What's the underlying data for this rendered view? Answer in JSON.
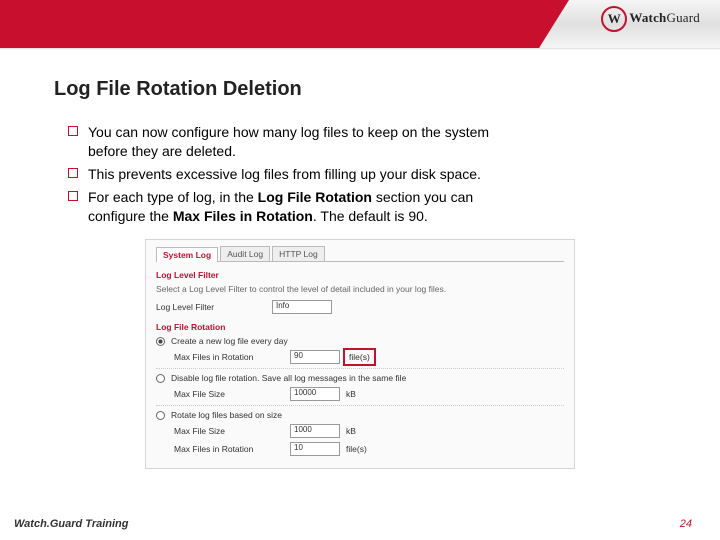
{
  "brand": {
    "name_a": "Watch",
    "name_b": "Guard",
    "mark": "W"
  },
  "title": "Log File Rotation Deletion",
  "bullets": {
    "b1a": "You can now configure how many log files to keep on the system",
    "b1b": "before they are deleted.",
    "b2": "This prevents excessive log files from filling up your disk space.",
    "b3a": "For each type of log, in the ",
    "b3bold1": "Log File Rotation",
    "b3b": " section you can",
    "b3c": "configure the ",
    "b3bold2": "Max Files in Rotation",
    "b3d": ". The default is 90."
  },
  "sshot": {
    "tabs": {
      "t1": "System Log",
      "t2": "Audit Log",
      "t3": "HTTP Log"
    },
    "sec1": "Log Level Filter",
    "desc1": "Select a Log Level Filter to control the level of detail included in your log files.",
    "llf_label": "Log Level Filter",
    "llf_value": "Info",
    "sec2": "Log File Rotation",
    "opt1": "Create a new log file every day",
    "maxfiles_label": "Max Files in Rotation",
    "maxfiles_value": "90",
    "unit_files": "file(s)",
    "opt2": "Disable log file rotation. Save all log messages in the same file",
    "maxsize_label": "Max File Size",
    "maxsize_value": "10000",
    "unit_kb": "kB",
    "opt3": "Rotate log files based on size",
    "maxsize2_value": "1000",
    "maxfiles2_value": "10"
  },
  "footer": {
    "left": "Watch.Guard Training",
    "page": "24"
  }
}
